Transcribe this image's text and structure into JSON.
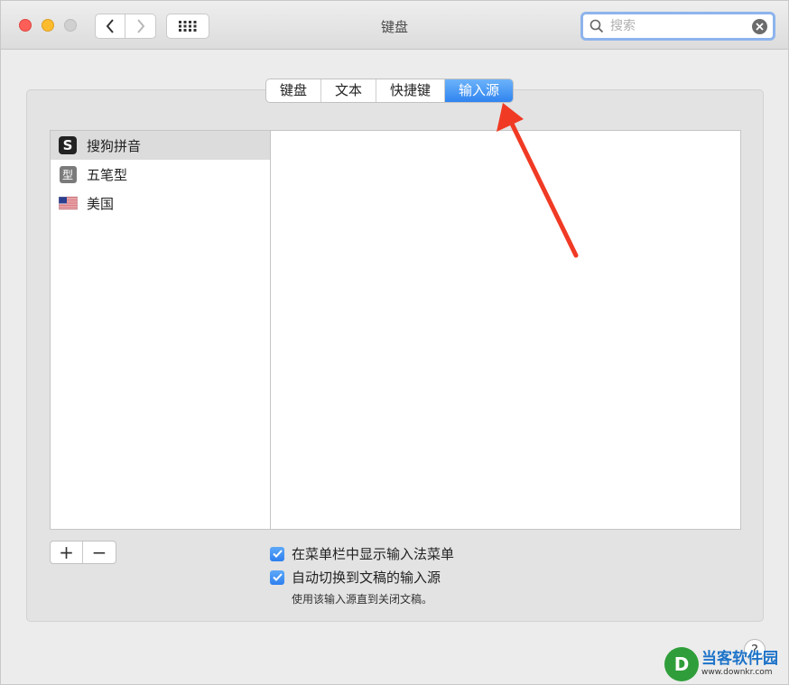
{
  "window": {
    "title": "键盘"
  },
  "search": {
    "placeholder": "搜索"
  },
  "tabs": [
    {
      "label": "键盘",
      "active": false
    },
    {
      "label": "文本",
      "active": false
    },
    {
      "label": "快捷键",
      "active": false
    },
    {
      "label": "输入源",
      "active": true
    }
  ],
  "input_sources": [
    {
      "label": "搜狗拼音",
      "icon": "sogou-icon",
      "icon_text": "S",
      "selected": true
    },
    {
      "label": "五笔型",
      "icon": "wubi-icon",
      "icon_text": "型",
      "selected": false
    },
    {
      "label": "美国",
      "icon": "us-flag-icon",
      "selected": false
    }
  ],
  "buttons": {
    "add": "+",
    "remove": "−",
    "help": "?"
  },
  "options": {
    "show_menu": {
      "label": "在菜单栏中显示输入法菜单",
      "checked": true
    },
    "auto_switch": {
      "label": "自动切换到文稿的输入源",
      "checked": true
    },
    "hint": "使用该输入源直到关闭文稿。"
  },
  "watermark": {
    "title": "当客软件园",
    "url": "www.downkr.com",
    "logo_text": "D"
  },
  "colors": {
    "accent": "#2f84f0",
    "arrow": "#f03a24"
  }
}
